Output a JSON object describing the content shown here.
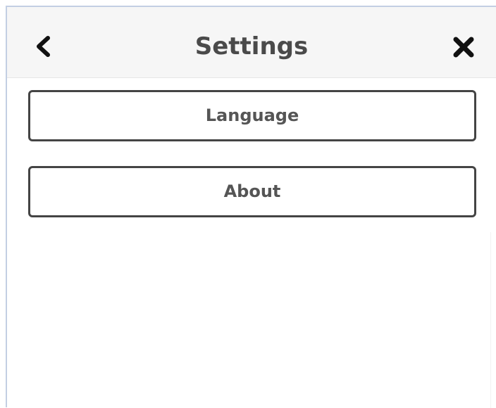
{
  "header": {
    "title": "Settings",
    "back_icon": "chevron-left-icon",
    "close_icon": "close-x-icon"
  },
  "menu": {
    "items": [
      {
        "label": "Language"
      },
      {
        "label": "About"
      }
    ]
  },
  "colors": {
    "header_bg": "#f6f6f6",
    "title_text": "#4a4a4a",
    "button_border": "#444444",
    "button_text": "#555555",
    "panel_border": "#c3cfe3"
  }
}
